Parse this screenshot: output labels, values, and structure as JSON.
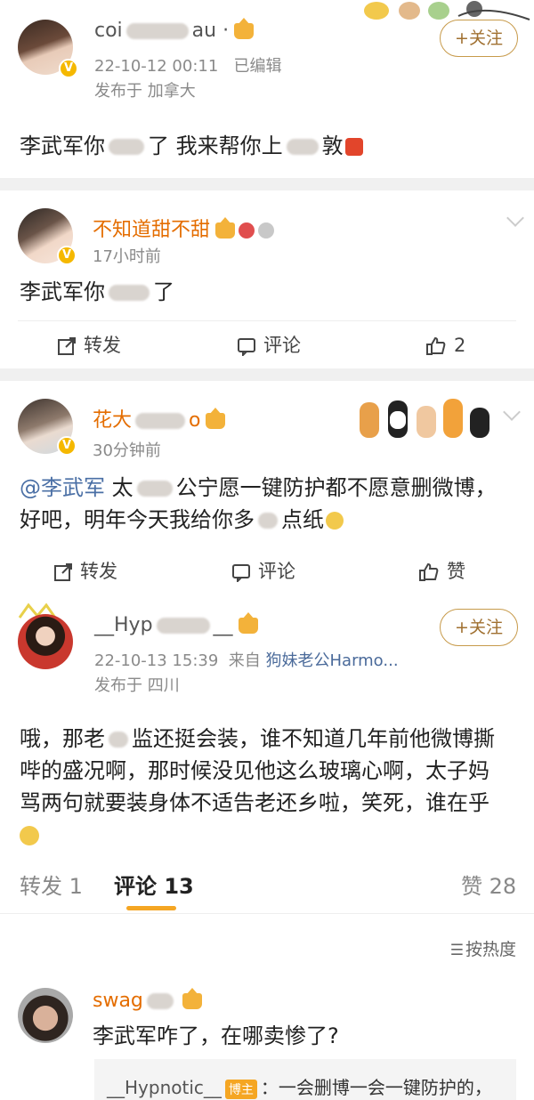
{
  "posts": [
    {
      "name": "coi",
      "name_tail": "au",
      "timestamp": "22-10-12 00:11",
      "edited": "已编辑",
      "location": "发布于 加拿大",
      "follow": "+关注",
      "content_a": "李武军你",
      "content_b": "了 我来帮你上",
      "content_c": "敦"
    }
  ],
  "comment1": {
    "name": "不知道甜不甜",
    "time": "17小时前",
    "content_a": "李武军你",
    "content_b": "了",
    "actions": {
      "repost": "转发",
      "comment": "评论",
      "like": "2"
    }
  },
  "comment2": {
    "name": "花大",
    "name_tail": "o",
    "time": "30分钟前",
    "mention": "@李武军",
    "line1_a": "太",
    "line1_b": "公宁愿一键防护都不愿意删微博，",
    "line2_a": "好吧，明年今天我给你多",
    "line2_b": "点纸",
    "actions": {
      "repost": "转发",
      "comment": "评论",
      "like": "赞"
    }
  },
  "post2": {
    "name": "__Hyp",
    "name_tail": "__",
    "timestamp": "22-10-13 15:39",
    "from_label": "来自",
    "source": "狗妹老公Harmo...",
    "location": "发布于 四川",
    "follow": "+关注",
    "line1_a": "哦，那老",
    "line1_b": "监还挺会装，谁不知道几年前他微博撕",
    "line2": "哔的盛况啊，那时候没见他这么玻璃心啊，太子妈",
    "line3": "骂两句就要装身体不适告老还乡啦，笑死，谁在乎"
  },
  "tabs": {
    "repost": "转发 1",
    "comment": "评论 13",
    "like": "赞 28"
  },
  "sort_label": "按热度",
  "reply": {
    "name": "swag",
    "content": "李武军咋了，在哪卖惨了?",
    "sub_name": "__Hypnotic__",
    "host_tag": "博主",
    "sub_content": "：一会删博一会一键防护的，"
  }
}
